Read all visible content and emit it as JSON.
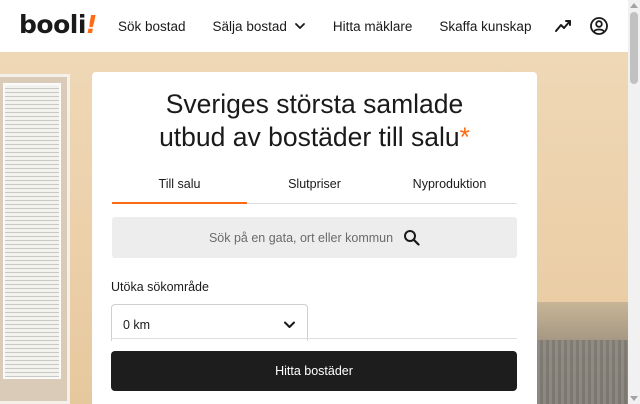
{
  "header": {
    "logo_text": "booli",
    "logo_mark": "!",
    "nav": [
      {
        "label": "Sök bostad"
      },
      {
        "label": "Sälja bostad"
      },
      {
        "label": "Hitta mäklare"
      },
      {
        "label": "Skaffa kunskap"
      }
    ],
    "icons": [
      "trend-icon",
      "account-icon"
    ]
  },
  "card": {
    "title_line1": "Sveriges största samlade",
    "title_line2": "utbud av bostäder till salu",
    "title_star": "*",
    "tabs": [
      {
        "label": "Till salu",
        "active": true
      },
      {
        "label": "Slutpriser",
        "active": false
      },
      {
        "label": "Nyproduktion",
        "active": false
      }
    ],
    "search": {
      "placeholder": "Sök på en gata, ort eller kommun"
    },
    "area": {
      "label": "Utöka sökområde",
      "selected": "0 km"
    },
    "submit_label": "Hitta bostäder"
  },
  "colors": {
    "accent": "#ff6a13",
    "button": "#1d1d1d",
    "search_bg": "#ededed"
  }
}
